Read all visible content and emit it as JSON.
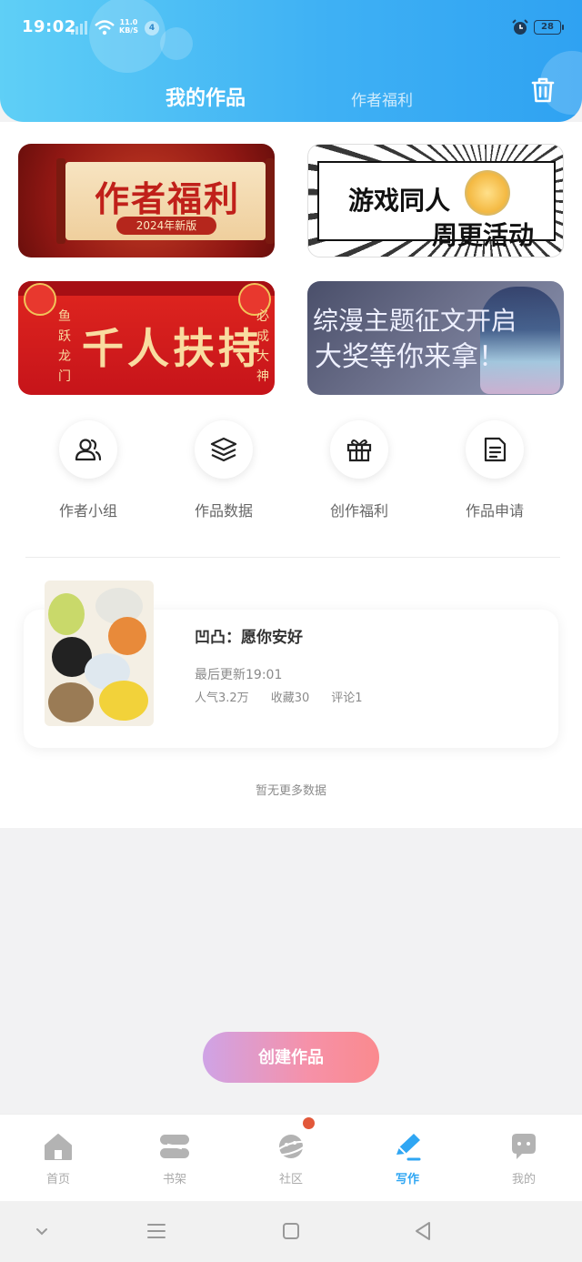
{
  "status_bar": {
    "time": "19:02",
    "net_speed_value": "11.0",
    "net_speed_unit": "KB/S",
    "notification_count": "4",
    "battery": "28"
  },
  "header": {
    "tab_active": "我的作品",
    "tab_inactive": "作者福利"
  },
  "banners": [
    {
      "title": "作者福利",
      "subtitle": "2024年新版"
    },
    {
      "line1": "游戏同人",
      "line2": "周更活动"
    },
    {
      "title": "千人扶持",
      "left_text": "鱼跃龙门",
      "right_text": "必成大神"
    },
    {
      "line1": "综漫主题征文开启",
      "line2": "大奖等你来拿！"
    }
  ],
  "quick_actions": [
    {
      "label": "作者小组",
      "icon": "users-icon"
    },
    {
      "label": "作品数据",
      "icon": "layers-icon"
    },
    {
      "label": "创作福利",
      "icon": "gift-icon"
    },
    {
      "label": "作品申请",
      "icon": "document-icon"
    }
  ],
  "work": {
    "title": "凹凸：愿你安好",
    "updated": "最后更新19:01",
    "popularity": "人气3.2万",
    "favorites": "收藏30",
    "comments": "评论1"
  },
  "list_footer": "暂无更多数据",
  "create_button": "创建作品",
  "bottom_nav": [
    {
      "label": "首页",
      "icon": "home-icon"
    },
    {
      "label": "书架",
      "icon": "bookshelf-icon"
    },
    {
      "label": "社区",
      "icon": "planet-icon"
    },
    {
      "label": "写作",
      "icon": "pen-icon"
    },
    {
      "label": "我的",
      "icon": "chat-bubble-icon"
    }
  ],
  "colors": {
    "header_blue": "#3fb1f4",
    "active_tab": "#2fa6f3",
    "badge_red": "#e2583a",
    "create_gradient_start": "#cfa3e6",
    "create_gradient_end": "#fa8a8e"
  }
}
